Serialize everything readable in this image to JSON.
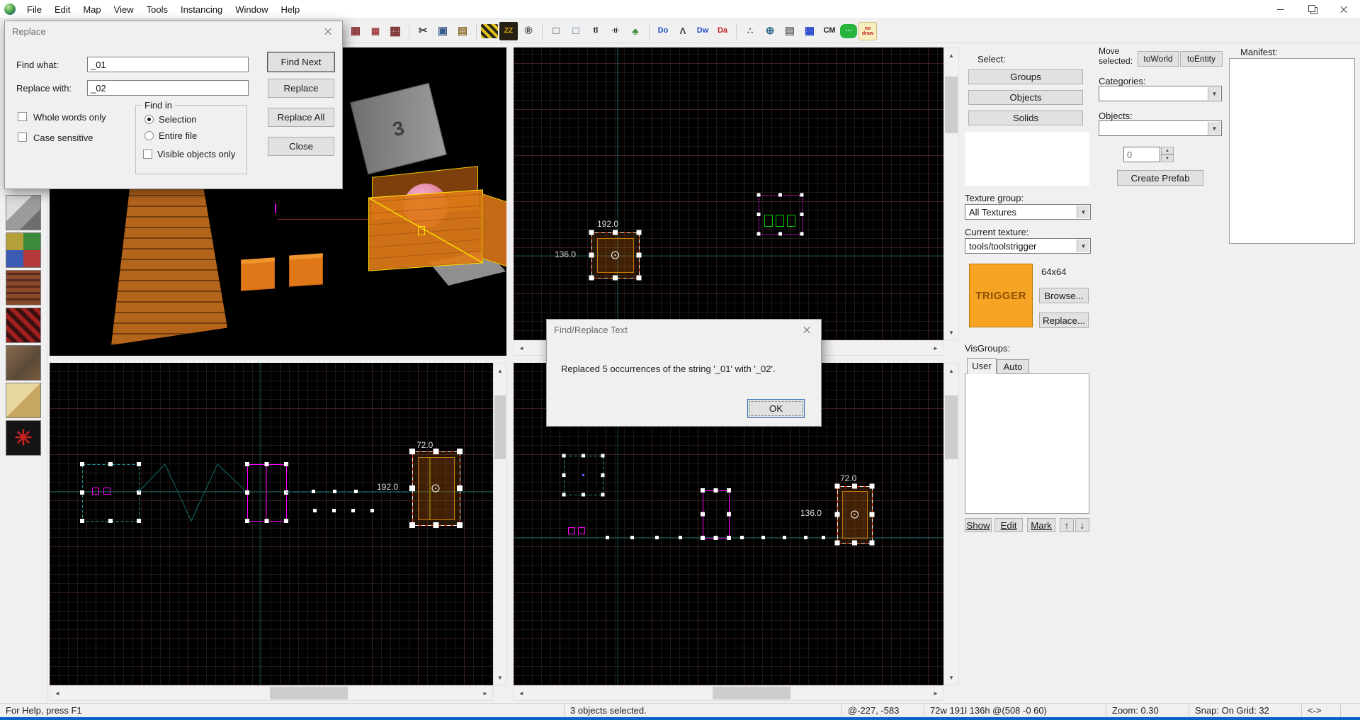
{
  "window": {
    "menu_items": [
      "File",
      "Edit",
      "Map",
      "View",
      "Tools",
      "Instancing",
      "Window",
      "Help"
    ]
  },
  "toolbar": {
    "icons": [
      {
        "name": "toggle-3d-grid-icon",
        "glyph": "▦",
        "fg": "#8a3434",
        "fs": 15
      },
      {
        "name": "smaller-grid-icon",
        "glyph": "▦",
        "fg": "#a04040",
        "fs": 13
      },
      {
        "name": "larger-grid-icon",
        "glyph": "▦",
        "fg": "#7a2e2e",
        "fs": 17
      },
      {
        "sep": true
      },
      {
        "name": "cut-icon",
        "glyph": "✂",
        "fg": "#444444",
        "fs": 15
      },
      {
        "name": "copy-icon",
        "glyph": "▣",
        "fg": "#3a5a8a",
        "fs": 15
      },
      {
        "name": "paste-icon",
        "glyph": "▤",
        "fg": "#8a6a2a",
        "fs": 15
      },
      {
        "sep": true
      },
      {
        "name": "apply-texture-icon",
        "glyph": "",
        "style": "stripes"
      },
      {
        "name": "sleep-zz-icon",
        "glyph": "ZZ",
        "fg": "#e0b000",
        "bg": "#262014",
        "fs": 10
      },
      {
        "name": "circle-r-icon",
        "glyph": "®",
        "fg": "#333333",
        "fs": 15
      },
      {
        "sep": true
      },
      {
        "name": "select-box-icon",
        "glyph": "□",
        "fg": "#3c3c3c",
        "fs": 15
      },
      {
        "name": "select-touching-icon",
        "glyph": "□",
        "fg": "#2a5a8a",
        "fs": 15
      },
      {
        "name": "texture-lock-icon",
        "glyph": "tl",
        "fg": "#222222",
        "fs": 11
      },
      {
        "name": "texture-lock-scale-icon",
        "glyph": "·tl·",
        "fg": "#222222",
        "fs": 9
      },
      {
        "name": "foliage-icon",
        "glyph": "♣",
        "fg": "#3f8f3f",
        "fs": 14
      },
      {
        "sep": true
      },
      {
        "name": "displacement-do-icon",
        "glyph": "Do",
        "fg": "#2050c8",
        "fs": 11
      },
      {
        "name": "carve-icon",
        "glyph": "Λ",
        "fg": "#444444",
        "fs": 13
      },
      {
        "name": "displacement-dw-icon",
        "glyph": "Dw",
        "fg": "#2050c8",
        "fs": 11
      },
      {
        "name": "displacement-da-icon",
        "glyph": "Da",
        "fg": "#c82020",
        "fs": 11
      },
      {
        "sep": true
      },
      {
        "name": "scatter-icon",
        "glyph": "∴",
        "fg": "#555555",
        "fs": 13
      },
      {
        "name": "cordon-icon",
        "glyph": "⊕",
        "fg": "#2a6a8a",
        "fs": 15
      },
      {
        "name": "brick-wall-icon",
        "glyph": "▤",
        "fg": "#707070",
        "fs": 15
      },
      {
        "name": "blue-grid-icon",
        "glyph": "▦",
        "fg": "#2244cc",
        "fs": 15
      },
      {
        "name": "cm-icon",
        "glyph": "CM",
        "fg": "#222222",
        "fs": 11
      },
      {
        "name": "chat-icon",
        "glyph": "⋯",
        "style": "bubble",
        "fs": 10
      },
      {
        "name": "nodraw-icon",
        "glyph": "no\ndraw",
        "style": "nodraw",
        "fs": 7
      }
    ]
  },
  "left_toolbar": {
    "thumbnails": [
      {
        "name": "texture-thumb-grey-cube",
        "cls": "cube-grey",
        "glyph": ""
      },
      {
        "name": "texture-thumb-multicolor-cube",
        "cls": "cube-multi",
        "glyph": ""
      },
      {
        "name": "texture-thumb-brick-cube",
        "cls": "cube-brick",
        "glyph": ""
      },
      {
        "name": "texture-thumb-red-cube",
        "cls": "cube-red",
        "glyph": ""
      },
      {
        "name": "texture-thumb-rock-cube",
        "cls": "cube-rock",
        "glyph": ""
      },
      {
        "name": "texture-thumb-tan-cube",
        "cls": "cube-tan",
        "glyph": ""
      },
      {
        "name": "texture-thumb-lattice-sphere",
        "cls": "sphere-lattice",
        "glyph": "✳"
      }
    ]
  },
  "replace_dialog": {
    "title": "Replace",
    "find_what_label": "Find what:",
    "find_what_value": "_01",
    "replace_with_label": "Replace with:",
    "replace_with_value": "_02",
    "whole_words_label": "Whole words only",
    "case_sensitive_label": "Case sensitive",
    "find_in_label": "Find in",
    "selection_label": "Selection",
    "entire_file_label": "Entire file",
    "visible_objects_label": "Visible objects only",
    "selected_option": "Selection",
    "find_next_label": "Find Next",
    "replace_label": "Replace",
    "replace_all_label": "Replace All",
    "close_label": "Close"
  },
  "message_dialog": {
    "title": "Find/Replace Text",
    "message": "Replaced 5 occurrences of the string '_01' with '_02'.",
    "ok_label": "OK"
  },
  "viewports": {
    "three_d": {
      "block_number": "3"
    },
    "top_right": {
      "width_label": "192.0",
      "height_label": "136.0"
    },
    "bottom_left": {
      "top_label": "72.0",
      "left_label": "192.0"
    },
    "bottom_right": {
      "top_label": "72.0",
      "left_label": "136.0"
    }
  },
  "side_panel": {
    "select_label": "Select:",
    "select_buttons": [
      "Groups",
      "Objects",
      "Solids"
    ],
    "texture_group_label": "Texture group:",
    "texture_group_value": "All Textures",
    "current_texture_label": "Current texture:",
    "current_texture_value": "tools/toolstrigger",
    "texture_preview_text": "TRIGGER",
    "texture_size": "64x64",
    "browse_label": "Browse...",
    "replace_label": "Replace...",
    "visgroups_label": "VisGroups:",
    "tabs": [
      "User",
      "Auto"
    ],
    "show_label": "Show",
    "edit_label": "Edit",
    "mark_label": "Mark",
    "arrow_up": "↑",
    "arrow_down": "↓"
  },
  "move_panel": {
    "move_selected_label": "Move selected:",
    "to_world_label": "toWorld",
    "to_entity_label": "toEntity",
    "categories_label": "Categories:",
    "objects_label": "Objects:",
    "spinner_value": "0",
    "create_prefab_label": "Create Prefab"
  },
  "manifest": {
    "label": "Manifest:"
  },
  "statusbar": {
    "help": "For Help, press F1",
    "selection": "3 objects selected.",
    "coords": "@-227, -583",
    "size": "72w 191l 136h @(508 -0 60)",
    "zoom": "Zoom: 0.30",
    "snap": "Snap: On Grid: 32",
    "arrows": "<->"
  },
  "colors": {
    "accent_blue": "#0c62c7",
    "selection_red": "#ff3800",
    "texture_orange": "#f7a424",
    "grid_teal": "#156868",
    "magenta": "#ff00ff"
  }
}
